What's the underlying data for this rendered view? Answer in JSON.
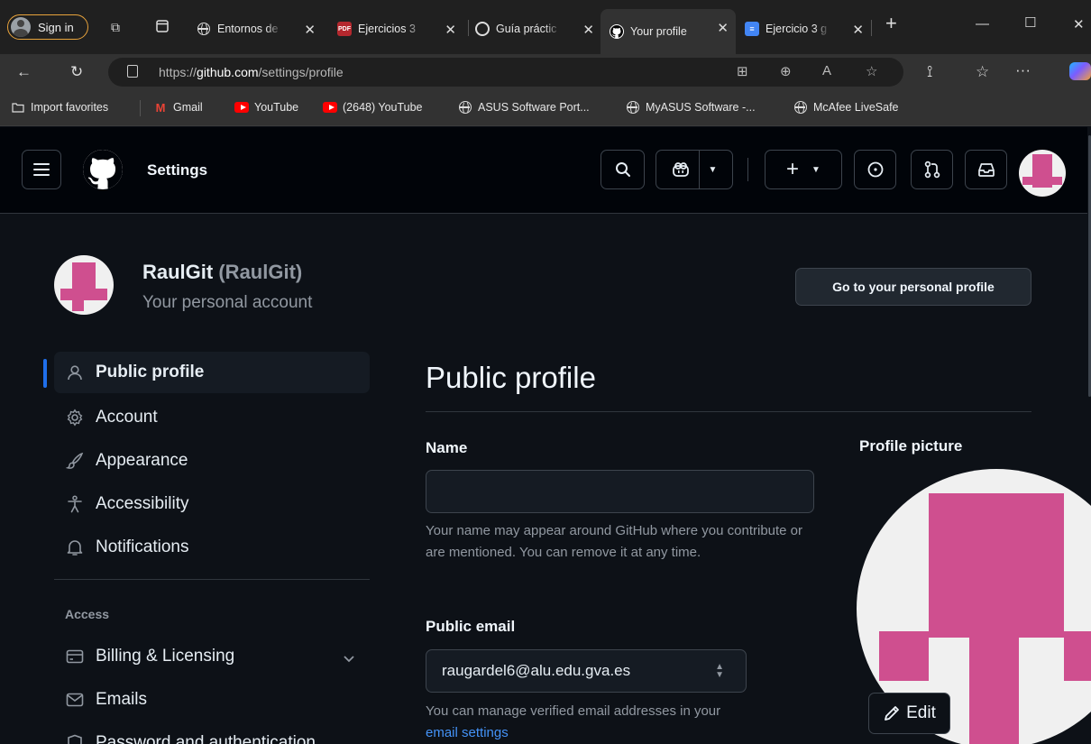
{
  "browser": {
    "signin_label": "Sign in",
    "tabs": [
      {
        "label": "Entornos de",
        "favicon": "globe-icon"
      },
      {
        "label": "Ejercicios 3",
        "favicon": "pdf-icon"
      },
      {
        "label": "Guía práctic",
        "favicon": "chatgpt-icon"
      },
      {
        "label": "Your profile",
        "favicon": "github-icon",
        "active": true
      },
      {
        "label": "Ejercicio 3 g",
        "favicon": "google-docs-icon"
      }
    ],
    "url_prefix": "https://",
    "url_host": "github.com",
    "url_path": "/settings/profile",
    "bookmarks": [
      {
        "label": "Import favorites",
        "icon": "import-icon"
      },
      {
        "label": "Gmail",
        "icon": "gmail-icon"
      },
      {
        "label": "YouTube",
        "icon": "youtube-icon"
      },
      {
        "label": "(2648) YouTube",
        "icon": "youtube-icon"
      },
      {
        "label": "ASUS Software Port...",
        "icon": "globe-icon"
      },
      {
        "label": "MyASUS Software -...",
        "icon": "globe-icon"
      },
      {
        "label": "McAfee LiveSafe",
        "icon": "globe-icon"
      }
    ]
  },
  "header": {
    "title": "Settings"
  },
  "account": {
    "display_name": "RaulGit",
    "login": "(RaulGit)",
    "subtitle": "Your personal account",
    "go_to_profile_label": "Go to your personal profile"
  },
  "sidebar": {
    "items": [
      {
        "label": "Public profile",
        "icon": "person-icon",
        "selected": true
      },
      {
        "label": "Account",
        "icon": "gear-icon"
      },
      {
        "label": "Appearance",
        "icon": "paintbrush-icon"
      },
      {
        "label": "Accessibility",
        "icon": "accessibility-icon"
      },
      {
        "label": "Notifications",
        "icon": "bell-icon"
      }
    ],
    "access_heading": "Access",
    "access_items": [
      {
        "label": "Billing & Licensing",
        "icon": "credit-card-icon"
      },
      {
        "label": "Emails",
        "icon": "mail-icon"
      },
      {
        "label": "Password and authentication",
        "icon": "shield-lock-icon"
      }
    ]
  },
  "main": {
    "title": "Public profile",
    "name_label": "Name",
    "name_value": "",
    "name_help": "Your name may appear around GitHub where you contribute or are mentioned. You can remove it at any time.",
    "email_label": "Public email",
    "email_value": "raugardel6@alu.edu.gva.es",
    "email_help": "You can manage verified email addresses in your",
    "email_help_link": "email settings",
    "picture_label": "Profile picture",
    "edit_label": "Edit"
  },
  "colors": {
    "accent": "#1f6feb",
    "identicon": "#cf4f8f",
    "link": "#4493f8"
  }
}
